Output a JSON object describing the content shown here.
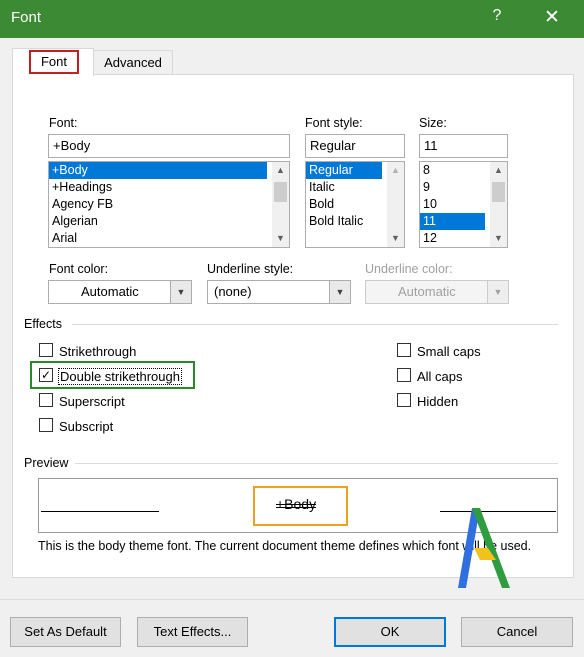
{
  "window": {
    "title": "Font",
    "help_glyph": "?",
    "close_glyph": "✕"
  },
  "tabs": [
    {
      "label": "Font"
    },
    {
      "label": "Advanced"
    }
  ],
  "font": {
    "label": "Font:",
    "value": "+Body",
    "items": [
      "+Body",
      "+Headings",
      "Agency FB",
      "Algerian",
      "Arial"
    ],
    "selected": "+Body"
  },
  "style": {
    "label": "Font style:",
    "value": "Regular",
    "items": [
      "Regular",
      "Italic",
      "Bold",
      "Bold Italic"
    ],
    "selected": "Regular"
  },
  "size": {
    "label": "Size:",
    "value": "11",
    "items": [
      "8",
      "9",
      "10",
      "11",
      "12"
    ],
    "selected": "11"
  },
  "font_color": {
    "label": "Font color:",
    "value": "Automatic"
  },
  "underline_style": {
    "label": "Underline style:",
    "value": "(none)"
  },
  "underline_color": {
    "label": "Underline color:",
    "value": "Automatic",
    "disabled": true
  },
  "effects": {
    "label": "Effects",
    "strikethrough": {
      "label": "Strikethrough",
      "checked": false
    },
    "double_strikethrough": {
      "label": "Double strikethrough",
      "checked": true
    },
    "superscript": {
      "label": "Superscript",
      "checked": false
    },
    "subscript": {
      "label": "Subscript",
      "checked": false
    },
    "small_caps": {
      "label": "Small caps",
      "checked": false
    },
    "all_caps": {
      "label": "All caps",
      "checked": false
    },
    "hidden": {
      "label": "Hidden",
      "checked": false
    }
  },
  "preview": {
    "label": "Preview",
    "sample": "+Body",
    "description": "This is the body theme font. The current document theme defines which font will be used."
  },
  "buttons": {
    "set_default": "Set As Default",
    "text_effects": "Text Effects...",
    "ok": "OK",
    "cancel": "Cancel"
  },
  "colors": {
    "titlebar": "#3c8b34",
    "selection": "#0078d7",
    "tab_highlight": "#c81e1e",
    "checkbox_highlight": "#2a8a2a",
    "preview_highlight": "#f0a020"
  }
}
